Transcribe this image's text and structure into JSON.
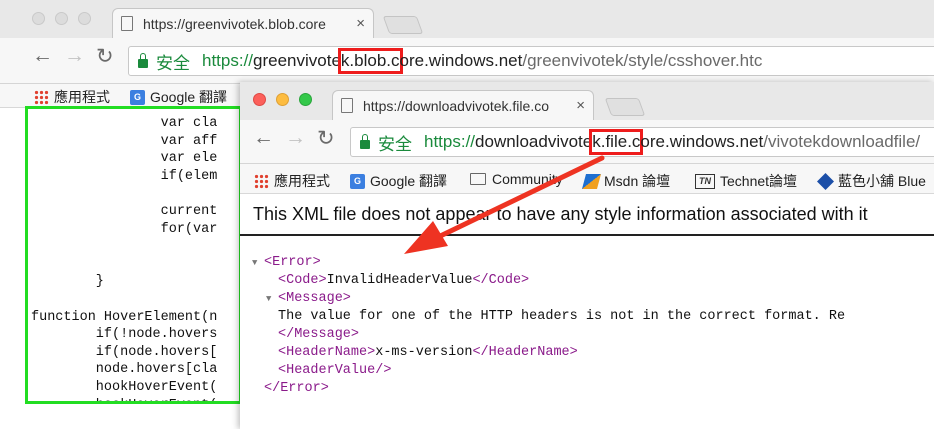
{
  "back_window": {
    "tab": {
      "title": "https://greenvivotek.blob.core",
      "close": "×"
    },
    "address": {
      "secure_label": "安全",
      "scheme": "https://",
      "host_pre": "greenvivote",
      "host_hl": "k.blob.c",
      "host_post": "ore.windows.net",
      "path": "/greenvivotek/style/csshover.htc"
    },
    "bookmarks": [
      {
        "label": "應用程式",
        "icon": "apps-grid-icon"
      },
      {
        "label": "Google 翻譯",
        "icon": "google-translate-icon"
      }
    ],
    "code_lines": [
      "                var cla",
      "                var aff",
      "                var ele",
      "                if(elem",
      "",
      "                current",
      "                for(var",
      "",
      "",
      "        }",
      "",
      "function HoverElement(n",
      "        if(!node.hovers",
      "        if(node.hovers[",
      "        node.hovers[cla",
      "        hookHoverEvent(",
      "        hookHoverEvent(",
      "}"
    ]
  },
  "front_window": {
    "tab": {
      "title": "https://downloadvivotek.file.co",
      "close": "×"
    },
    "address": {
      "secure_label": "安全",
      "scheme": "https://",
      "host_pre": "downloadvivote",
      "host_hl": "k.file.c",
      "host_post": "ore.windows.net",
      "path": "/vivotekdownloadfile/"
    },
    "bookmarks": [
      {
        "label": "應用程式",
        "icon": "apps-grid-icon"
      },
      {
        "label": "Google 翻譯",
        "icon": "google-translate-icon"
      },
      {
        "label": "Community",
        "icon": "folder-icon"
      },
      {
        "label": "Msdn 論壇",
        "icon": "msdn-icon"
      },
      {
        "label": "Technet論壇",
        "icon": "technet-icon"
      },
      {
        "label": "藍色小舖 Blue",
        "icon": "blue-diamond-icon"
      }
    ],
    "xml_banner": "This XML file does not appear to have any style information associated with it",
    "xml": {
      "error_open": "<Error>",
      "code_open": "<Code>",
      "code_value": "InvalidHeaderValue",
      "code_close": "</Code>",
      "message_open": "<Message>",
      "message_text": "The value for one of the HTTP headers is not in the correct format. Re",
      "message_close": "</Message>",
      "headername_open": "<HeaderName>",
      "headername_value": "x-ms-version",
      "headername_close": "</HeaderName>",
      "headervalue_tag": "<HeaderValue/>",
      "error_close": "</Error>"
    }
  },
  "colors": {
    "highlight_box": "#ee1c1c",
    "code_panel_border": "#22dd22",
    "arrow": "#ee3322",
    "xml_tag": "#8a1a8a",
    "secure_green": "#1a8a3c"
  }
}
